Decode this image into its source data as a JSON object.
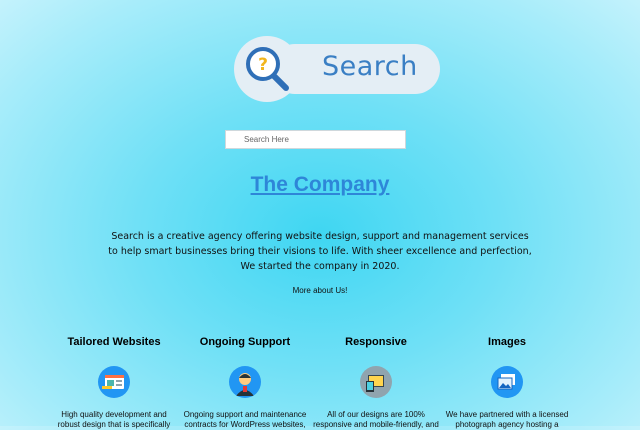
{
  "logo": {
    "text": "Search",
    "icon": "question-magnifier-icon"
  },
  "search": {
    "placeholder": "Search Here"
  },
  "company": {
    "title": "The Company"
  },
  "description": {
    "line1": "Search is a creative agency offering website design, support and management services",
    "line2": "to help smart businesses bring their visions to life. With sheer excellence and perfection,",
    "line3": "We started the company in 2020."
  },
  "more_link": "More about Us!",
  "features": [
    {
      "title": "Tailored Websites",
      "icon": "website-design-icon",
      "line1": "High quality development and",
      "line2": "robust design that is specifically"
    },
    {
      "title": "Ongoing Support",
      "icon": "support-agent-icon",
      "line1": "Ongoing support and maintenance",
      "line2": "contracts for WordPress websites,"
    },
    {
      "title": "Responsive",
      "icon": "responsive-devices-icon",
      "line1": "All of our designs are 100%",
      "line2": "responsive and mobile-friendly, and"
    },
    {
      "title": "Images",
      "icon": "photo-gallery-icon",
      "line1": "We have partnered with a licensed",
      "line2": "photograph agency hosting a"
    }
  ]
}
